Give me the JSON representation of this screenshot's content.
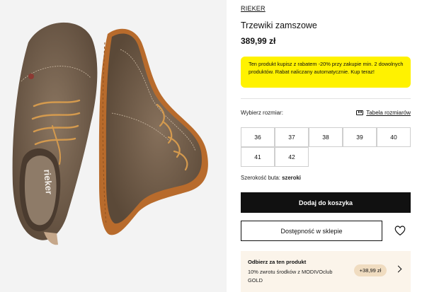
{
  "product": {
    "brand": "RIEKER",
    "title": "Trzewiki zamszowe",
    "price": "389,99 zł"
  },
  "promo": {
    "text": "Ten produkt kupisz z rabatem -20% przy zakupie min. 2 dowolnych produktów. Rabat naliczany automatycznie. Kup teraz!",
    "background": "#fff200"
  },
  "size_selector": {
    "label": "Wybierz rozmiar:",
    "table_link": "Tabela rozmiarów",
    "sizes": [
      "36",
      "37",
      "38",
      "39",
      "40",
      "41",
      "42"
    ]
  },
  "fit": {
    "label": "Szerokość buta:",
    "value": "szeroki"
  },
  "actions": {
    "add_to_cart": "Dodaj do koszyka",
    "store_availability": "Dostępność w sklepie"
  },
  "club": {
    "title": "Odbierz za ten produkt",
    "description": "10% zwrotu środków z MODIVOclub GOLD",
    "reward": "+38,99 zł"
  },
  "gallery": {
    "insole_logo": "rieker"
  },
  "icons": [
    "ruler-icon",
    "heart-icon",
    "chevron-right-icon"
  ]
}
